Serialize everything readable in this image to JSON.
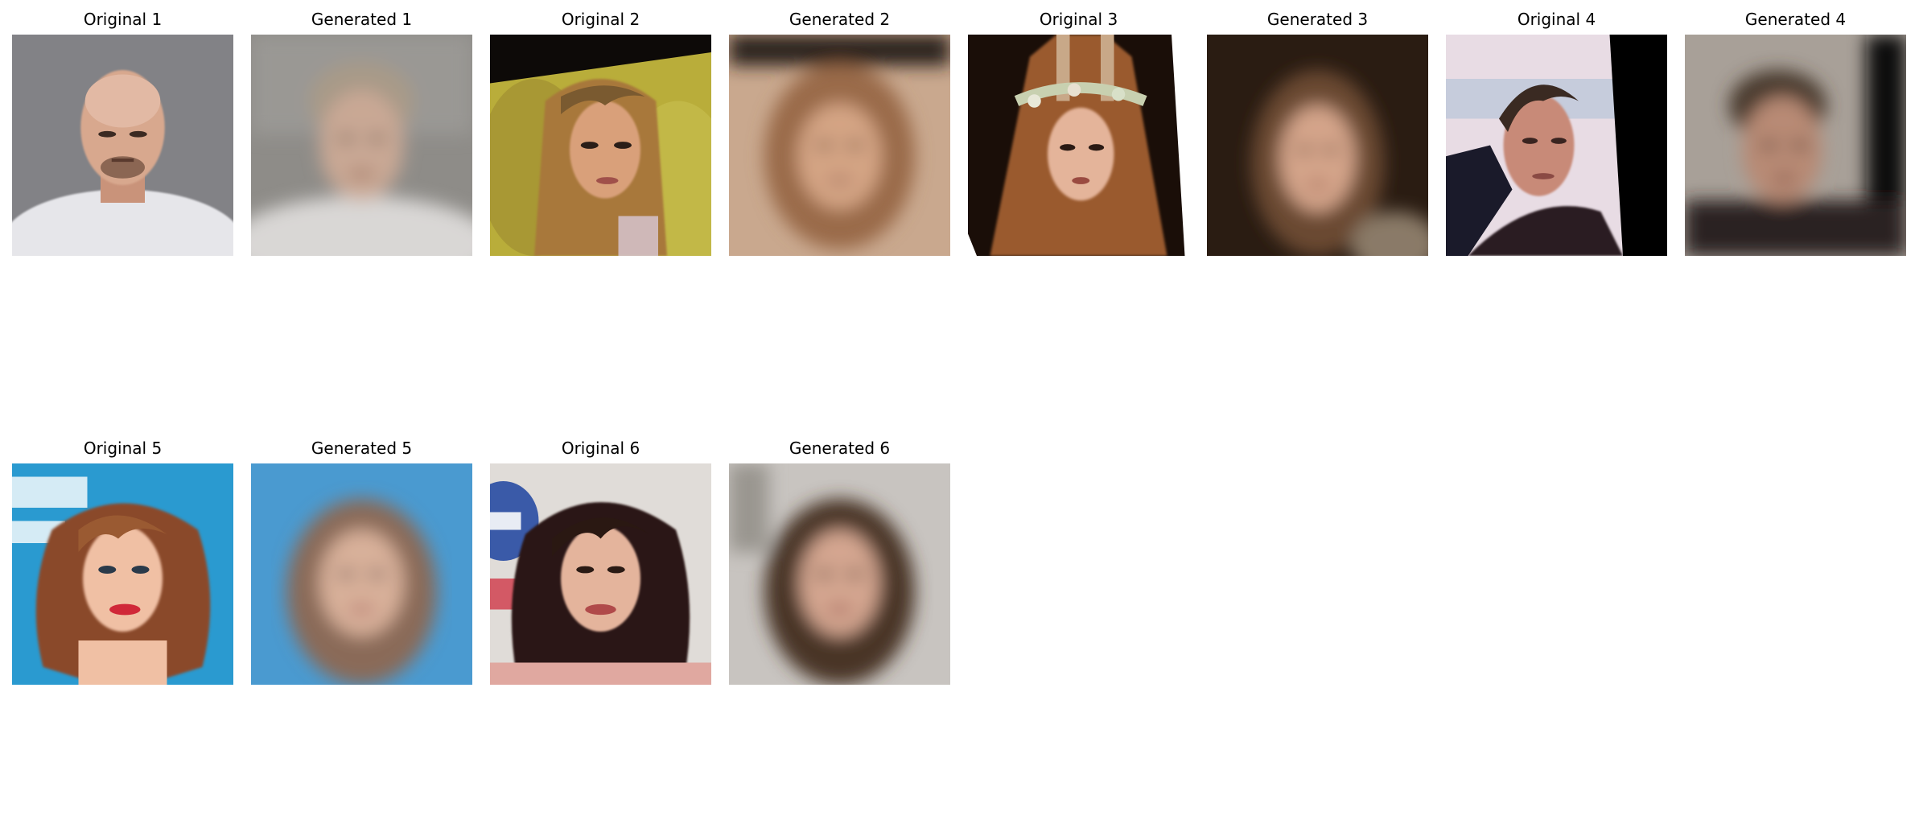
{
  "panels": [
    {
      "title": "Original 1"
    },
    {
      "title": "Generated 1"
    },
    {
      "title": "Original 2"
    },
    {
      "title": "Generated 2"
    },
    {
      "title": "Original 3"
    },
    {
      "title": "Generated 3"
    },
    {
      "title": "Original 4"
    },
    {
      "title": "Generated 4"
    },
    {
      "title": "Original 5"
    },
    {
      "title": "Generated 5"
    },
    {
      "title": "Original 6"
    },
    {
      "title": "Generated 6"
    }
  ],
  "colors": {
    "background": "#ffffff",
    "title_text": "#000000"
  }
}
